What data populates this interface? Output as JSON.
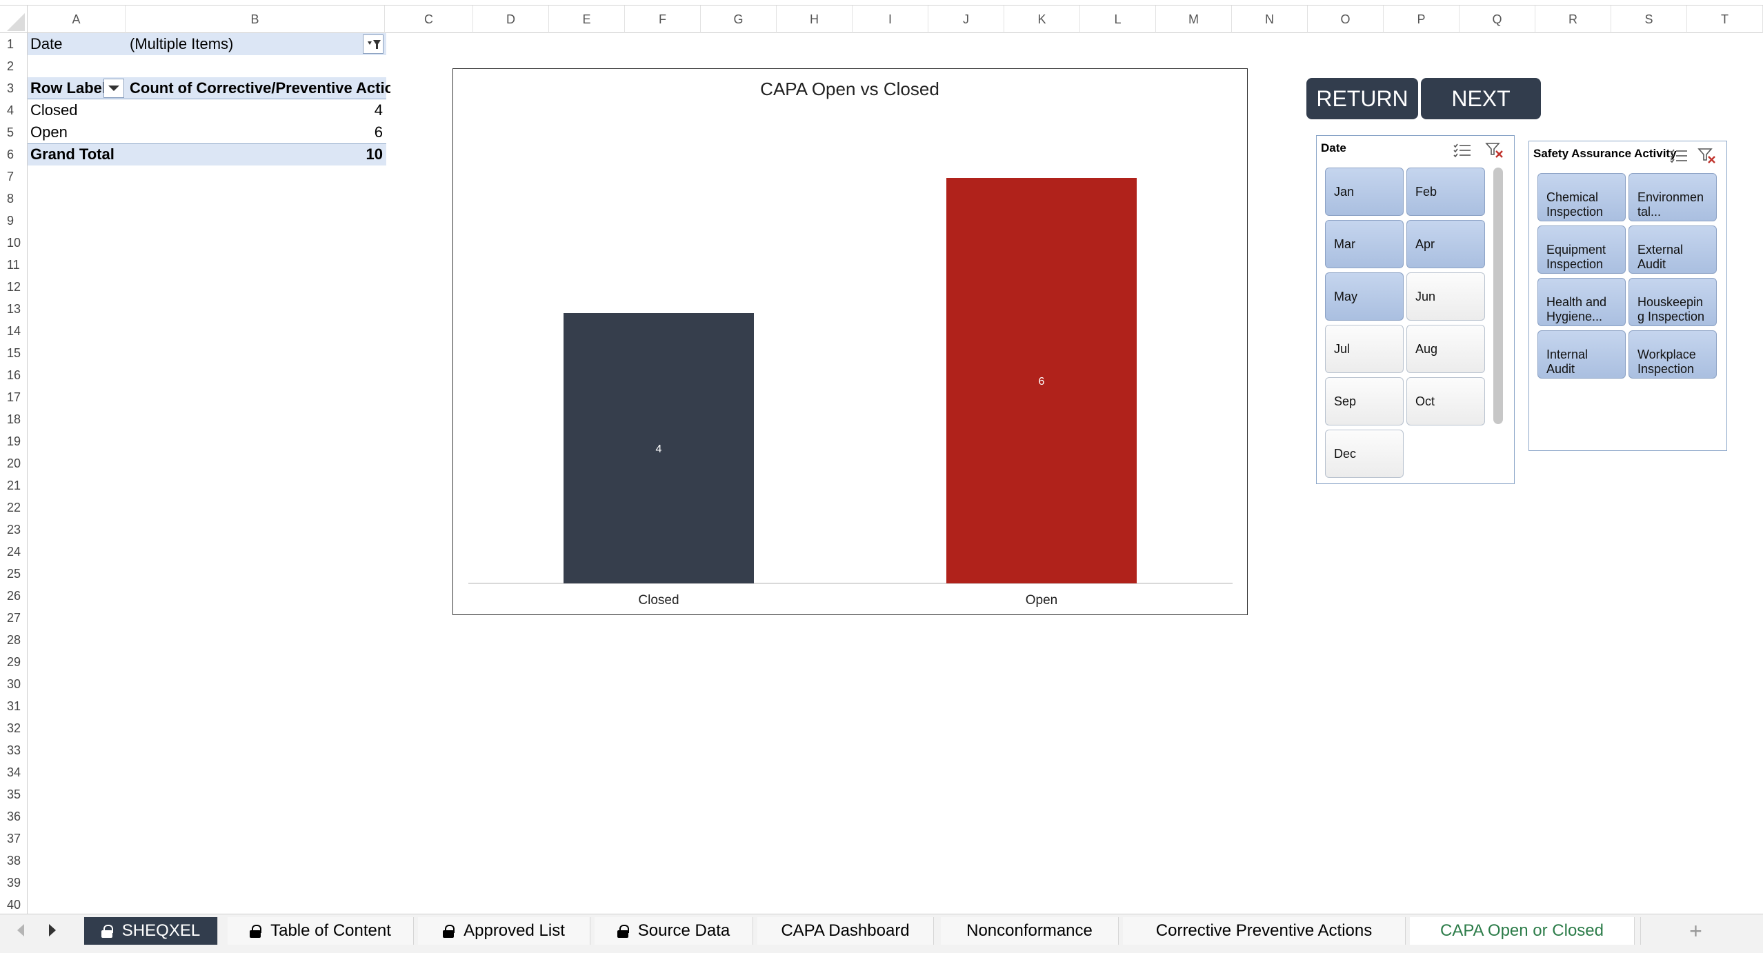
{
  "columns": [
    "A",
    "B",
    "C",
    "D",
    "E",
    "F",
    "G",
    "H",
    "I",
    "J",
    "K",
    "L",
    "M",
    "N",
    "O",
    "P",
    "Q",
    "R",
    "S",
    "T"
  ],
  "rows": [
    "1",
    "2",
    "3",
    "4",
    "5",
    "6",
    "7",
    "8",
    "9",
    "10",
    "11",
    "12",
    "13",
    "14",
    "15",
    "16",
    "17",
    "18",
    "19",
    "20",
    "21",
    "22",
    "23",
    "24",
    "25",
    "26",
    "27",
    "28",
    "29",
    "30",
    "31",
    "32",
    "33",
    "34",
    "35",
    "36",
    "37",
    "38",
    "39",
    "40"
  ],
  "pivot": {
    "filter_label": "Date",
    "filter_value": "(Multiple Items)",
    "row_labels_header": "Row Labels",
    "value_header": "Count of Corrective/Preventive Action",
    "items": [
      {
        "label": "Closed",
        "value": "4"
      },
      {
        "label": "Open",
        "value": "6"
      }
    ],
    "grand_total_label": "Grand Total",
    "grand_total_value": "10"
  },
  "chart_data": {
    "type": "bar",
    "title": "CAPA Open vs Closed",
    "categories": [
      "Closed",
      "Open"
    ],
    "values": [
      4,
      6
    ],
    "colors": [
      "#363e4c",
      "#b0221b"
    ],
    "ylim": [
      0,
      7
    ],
    "grid": false,
    "legend": "none"
  },
  "buttons": {
    "return_label": "RETURN",
    "next_label": "NEXT"
  },
  "date_slicer": {
    "title": "Date",
    "items": [
      {
        "label": "Jan",
        "selected": true
      },
      {
        "label": "Feb",
        "selected": true
      },
      {
        "label": "Mar",
        "selected": true
      },
      {
        "label": "Apr",
        "selected": true
      },
      {
        "label": "May",
        "selected": true
      },
      {
        "label": "Jun",
        "selected": false
      },
      {
        "label": "Jul",
        "selected": false
      },
      {
        "label": "Aug",
        "selected": false
      },
      {
        "label": "Sep",
        "selected": false
      },
      {
        "label": "Oct",
        "selected": false
      },
      {
        "label": "Dec",
        "selected": false
      }
    ]
  },
  "activity_slicer": {
    "title": "Safety Assurance Activity",
    "items": [
      {
        "line1": "Chemical",
        "line2": "Inspection"
      },
      {
        "line1": "Environmen",
        "line2": "tal..."
      },
      {
        "line1": "Equipment",
        "line2": "Inspection"
      },
      {
        "line1": "External",
        "line2": "Audit"
      },
      {
        "line1": "Health and",
        "line2": "Hygiene..."
      },
      {
        "line1": "Houskeepin",
        "line2": "g Inspection"
      },
      {
        "line1": "Internal",
        "line2": "Audit"
      },
      {
        "line1": "Workplace",
        "line2": "Inspection"
      }
    ]
  },
  "tabs": [
    {
      "label": "SHEQXEL",
      "locked": true,
      "style": "dark"
    },
    {
      "label": "Table of Content",
      "locked": true,
      "style": "normal"
    },
    {
      "label": "Approved List",
      "locked": true,
      "style": "normal"
    },
    {
      "label": "Source Data",
      "locked": true,
      "style": "normal"
    },
    {
      "label": "CAPA Dashboard",
      "locked": false,
      "style": "normal"
    },
    {
      "label": "Nonconformance",
      "locked": false,
      "style": "normal"
    },
    {
      "label": "Corrective Preventive Actions",
      "locked": false,
      "style": "normal"
    },
    {
      "label": "CAPA Open or Closed",
      "locked": false,
      "style": "active"
    }
  ],
  "add_sheet_label": "+"
}
